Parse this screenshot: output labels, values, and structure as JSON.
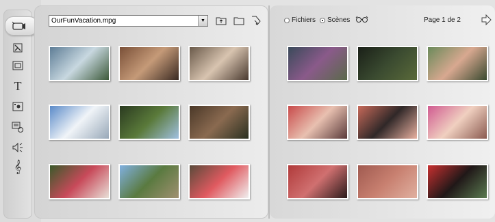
{
  "sidebar": {
    "tools": [
      {
        "name": "video-tool-icon",
        "active": true
      },
      {
        "name": "transition-tool-icon"
      },
      {
        "name": "theme-tool-icon"
      },
      {
        "name": "title-tool-icon",
        "glyph": "T"
      },
      {
        "name": "photo-tool-icon"
      },
      {
        "name": "disc-menu-tool-icon"
      },
      {
        "name": "sound-effects-tool-icon"
      },
      {
        "name": "music-tool-icon"
      }
    ]
  },
  "left_panel": {
    "file_name": "OurFunVacation.mpg",
    "buttons": [
      "folder-up-icon",
      "folder-icon",
      "down-arrow-icon"
    ],
    "thumbnails": [
      {
        "colors": [
          "#5e7d96",
          "#c8d8e0",
          "#3d5a3a"
        ]
      },
      {
        "colors": [
          "#7a5038",
          "#c59a78",
          "#3a2a22"
        ]
      },
      {
        "colors": [
          "#6a5a4a",
          "#d8c4b0",
          "#4a3a30"
        ]
      },
      {
        "colors": [
          "#5a8ac8",
          "#f0f4f8",
          "#98a8b8"
        ]
      },
      {
        "colors": [
          "#2a3a20",
          "#5a7a3a",
          "#a0c0e0"
        ]
      },
      {
        "colors": [
          "#4a3828",
          "#8a6a50",
          "#2a3020"
        ]
      },
      {
        "colors": [
          "#3a5a2a",
          "#c84a5a",
          "#e8e0d8"
        ]
      },
      {
        "colors": [
          "#80b0e0",
          "#5a7a40",
          "#a09070"
        ]
      },
      {
        "colors": [
          "#5a4a3a",
          "#e05a60",
          "#f0f0f0"
        ]
      }
    ]
  },
  "right_panel": {
    "radio_files_label": "Fichiers",
    "radio_scenes_label": "Scènes",
    "page_label": "Page 1 de 2",
    "thumbnails": [
      {
        "colors": [
          "#3a4a5a",
          "#8a5a8a",
          "#5a6a4a"
        ]
      },
      {
        "colors": [
          "#1a2018",
          "#3a4a30",
          "#5a6a3a"
        ]
      },
      {
        "colors": [
          "#6a8a5a",
          "#d8a890",
          "#3a4a30"
        ]
      },
      {
        "colors": [
          "#c84a4a",
          "#e8c0b0",
          "#5a3a3a"
        ]
      },
      {
        "colors": [
          "#c86a5a",
          "#302828",
          "#e8b0a0"
        ]
      },
      {
        "colors": [
          "#d05a90",
          "#f0d0c0",
          "#8a5a50"
        ]
      },
      {
        "colors": [
          "#b03a3a",
          "#d07070",
          "#2a1a1a"
        ]
      },
      {
        "colors": [
          "#a05a50",
          "#c88070",
          "#e0b0a0"
        ]
      },
      {
        "colors": [
          "#c83030",
          "#201818",
          "#5a7a50"
        ]
      }
    ]
  }
}
